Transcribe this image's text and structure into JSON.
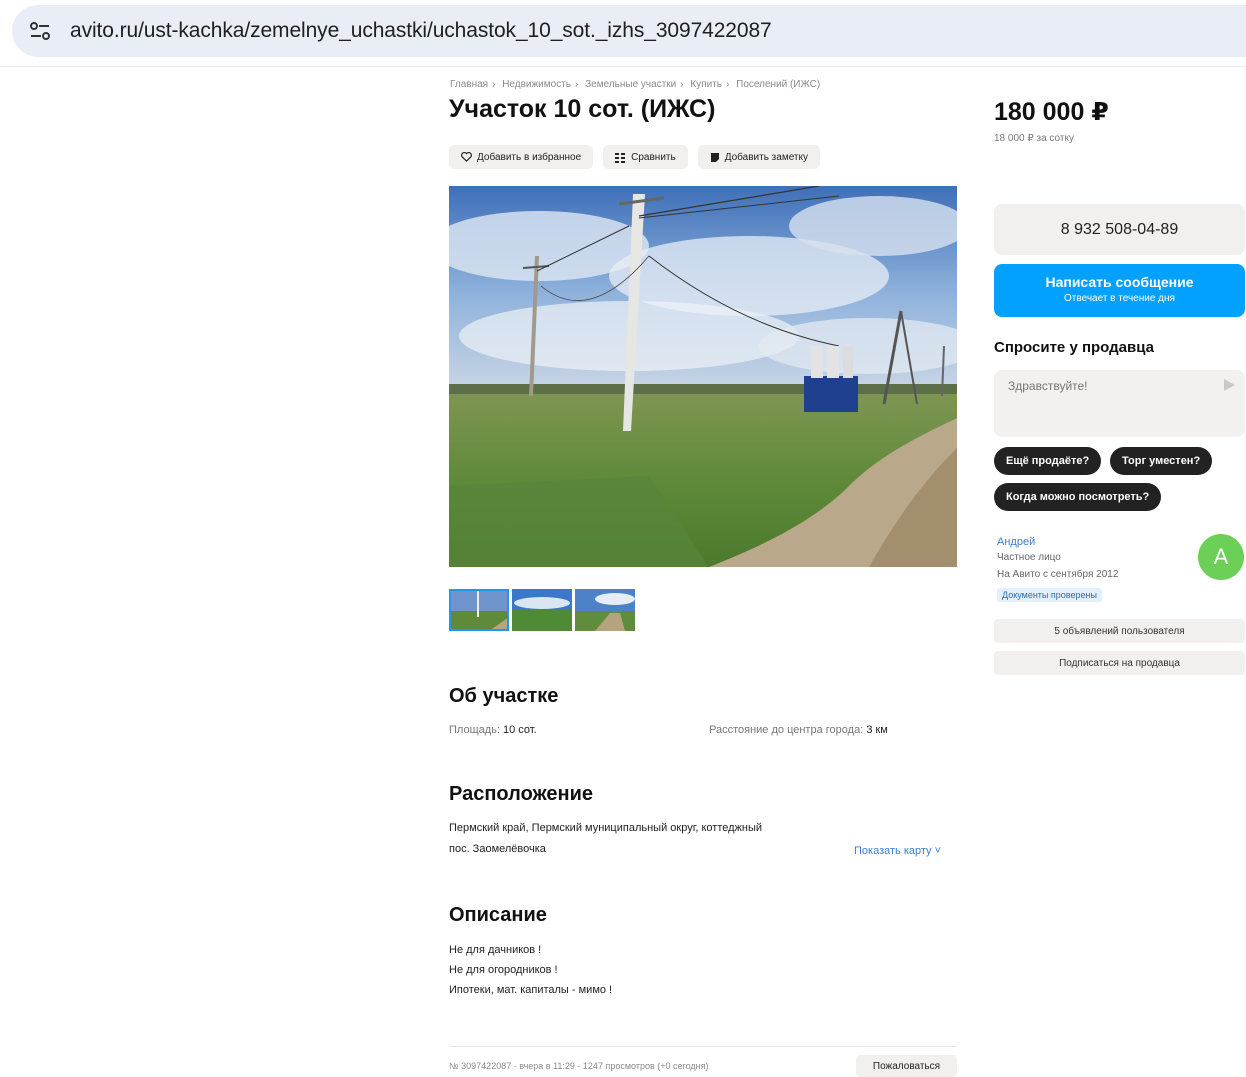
{
  "browser": {
    "url": "avito.ru/ust-kachka/zemelnye_uchastki/uchastok_10_sot._izhs_3097422087"
  },
  "breadcrumbs": [
    "Главная",
    "Недвижимость",
    "Земельные участки",
    "Купить",
    "Поселений (ИЖС)"
  ],
  "listing": {
    "title": "Участок 10 сот. (ИЖС)",
    "actions": {
      "favorite": "Добавить в избранное",
      "compare": "Сравнить",
      "note": "Добавить заметку"
    },
    "thumbnails_count": 3
  },
  "about": {
    "heading": "Об участке",
    "area_label": "Площадь:",
    "area_value": "10 сот.",
    "distance_label": "Расстояние до центра города:",
    "distance_value": "3 км"
  },
  "location": {
    "heading": "Расположение",
    "line1": "Пермский край, Пермский муниципальный округ, коттеджный",
    "line2": "пос. Заомелёвочка",
    "map_link": "Показать карту ˅"
  },
  "description": {
    "heading": "Описание",
    "lines": [
      "Не для дачников !",
      "Не для огородников !",
      "Ипотеки, мат. капиталы - мимо !"
    ]
  },
  "footer": {
    "meta": "№ 3097422087 · вчера в 11:29 · 1247 просмотров (+0 сегодня)",
    "complain": "Пожаловаться"
  },
  "sidebar": {
    "price": "180 000 ₽",
    "price_per_unit": "18 000 ₽ за сотку",
    "phone": "8 932 508-04-89",
    "message_button": "Написать сообщение",
    "message_sub": "Отвечает в течение дня",
    "ask_title": "Спросите у продавца",
    "ask_placeholder": "Здравствуйте!",
    "quick_questions": [
      "Ещё продаёте?",
      "Торг уместен?",
      "Когда можно посмотреть?"
    ],
    "seller": {
      "name": "Андрей",
      "type": "Частное лицо",
      "since": "На Авито с сентября 2012",
      "docs_badge": "Документы проверены",
      "avatar_letter": "А"
    },
    "user_ads": "5 объявлений пользователя",
    "subscribe": "Подписаться на продавца"
  },
  "colors": {
    "accent_blue": "#02a1ff",
    "avatar_green": "#6ccf57",
    "link_blue": "#3a7ed6"
  },
  "icons": [
    "settings-sliders-icon",
    "heart-icon",
    "compare-icon",
    "note-icon",
    "send-icon"
  ]
}
